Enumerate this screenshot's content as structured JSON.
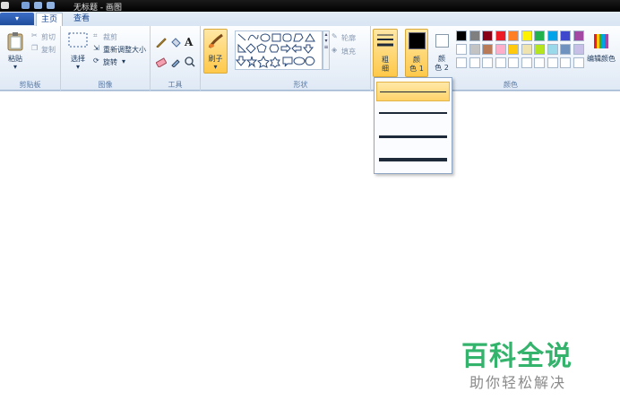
{
  "window": {
    "title": "无标题 - 画图"
  },
  "menu": {
    "file_label": "▾",
    "tabs": [
      {
        "label": "主页"
      },
      {
        "label": "查看"
      }
    ]
  },
  "clipboard": {
    "paste": "粘贴",
    "cut": "剪切",
    "copy": "复制",
    "group": "剪贴板"
  },
  "image": {
    "select": "选择",
    "crop": "裁剪",
    "resize": "重新调整大小",
    "rotate": "旋转",
    "group": "图像"
  },
  "tools": {
    "group": "工具",
    "text_glyph": "A"
  },
  "brushes": {
    "label": "刷子"
  },
  "shapes": {
    "outline": "轮廓",
    "fill": "填充",
    "group": "形状"
  },
  "size": {
    "label_line1": "粗",
    "label_line2": "细"
  },
  "colors": {
    "color1_line1": "颜",
    "color1_line2": "色 1",
    "color2_line1": "颜",
    "color2_line2": "色 2",
    "edit": "编辑颜色",
    "group": "颜色",
    "color1": "#000000",
    "color2": "#ffffff",
    "palette_row1": [
      "#000000",
      "#7f7f7f",
      "#880015",
      "#ed1c24",
      "#ff7f27",
      "#fff200",
      "#22b14c",
      "#00a2e8",
      "#3f48cc",
      "#a349a4"
    ],
    "palette_row2": [
      "#ffffff",
      "#c3c3c3",
      "#b97a57",
      "#ffaec9",
      "#ffc90e",
      "#efe4b0",
      "#b5e61d",
      "#99d9ea",
      "#7092be",
      "#c8bfe7"
    ],
    "palette_row3": [
      "#ffffff",
      "#ffffff",
      "#ffffff",
      "#ffffff",
      "#ffffff",
      "#ffffff",
      "#ffffff",
      "#ffffff",
      "#ffffff",
      "#ffffff"
    ]
  },
  "size_options": [
    {
      "thickness": 1,
      "selected": true
    },
    {
      "thickness": 2
    },
    {
      "thickness": 3
    },
    {
      "thickness": 5
    }
  ],
  "watermark": {
    "line1": "百科全说",
    "line2": "助你轻松解决"
  }
}
